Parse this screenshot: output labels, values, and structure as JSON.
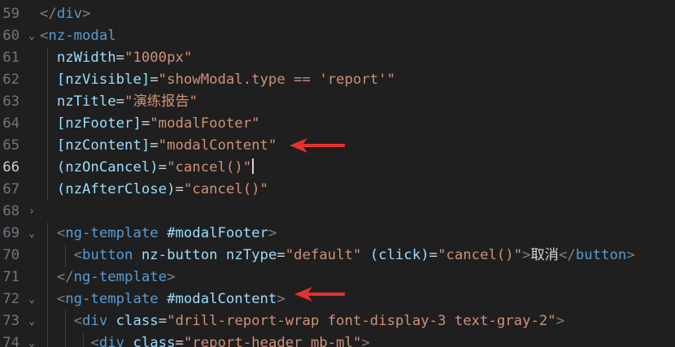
{
  "editor": {
    "active_line": "66",
    "fold_chevrons": {
      "down": "⌄",
      "right": "›"
    },
    "colors": {
      "background": "#1f1f1f",
      "tag": "#569cd6",
      "attribute": "#9cdcfe",
      "string": "#ce9178",
      "text": "#d4d4d4",
      "punctuation": "#808080",
      "annotation_arrow": "#e5322e"
    },
    "lines": [
      {
        "num": "59",
        "fold": "",
        "parts": [
          {
            "t": "</",
            "c": "gray"
          },
          {
            "t": "div",
            "c": "tag"
          },
          {
            "t": ">",
            "c": "gray"
          }
        ]
      },
      {
        "num": "60",
        "fold": "down",
        "parts": [
          {
            "t": "<",
            "c": "gray"
          },
          {
            "t": "nz-modal",
            "c": "tag"
          }
        ]
      },
      {
        "num": "61",
        "fold": "",
        "parts": [
          {
            "t": "  ",
            "c": "text"
          },
          {
            "t": "nzWidth",
            "c": "attr"
          },
          {
            "t": "=",
            "c": "text"
          },
          {
            "t": "\"1000px\"",
            "c": "str"
          }
        ]
      },
      {
        "num": "62",
        "fold": "",
        "parts": [
          {
            "t": "  ",
            "c": "text"
          },
          {
            "t": "[nzVisible]",
            "c": "attr"
          },
          {
            "t": "=",
            "c": "text"
          },
          {
            "t": "\"showModal.type == 'report'\"",
            "c": "str"
          }
        ]
      },
      {
        "num": "63",
        "fold": "",
        "parts": [
          {
            "t": "  ",
            "c": "text"
          },
          {
            "t": "nzTitle",
            "c": "attr"
          },
          {
            "t": "=",
            "c": "text"
          },
          {
            "t": "\"",
            "c": "str"
          },
          {
            "t": "演练报告",
            "c": "str cjk"
          },
          {
            "t": "\"",
            "c": "str"
          }
        ]
      },
      {
        "num": "64",
        "fold": "",
        "parts": [
          {
            "t": "  ",
            "c": "text"
          },
          {
            "t": "[nzFooter]",
            "c": "attr"
          },
          {
            "t": "=",
            "c": "text"
          },
          {
            "t": "\"modalFooter\"",
            "c": "str"
          }
        ]
      },
      {
        "num": "65",
        "fold": "",
        "parts": [
          {
            "t": "  ",
            "c": "text"
          },
          {
            "t": "[nzContent]",
            "c": "attr"
          },
          {
            "t": "=",
            "c": "text"
          },
          {
            "t": "\"modalContent\"",
            "c": "str"
          }
        ]
      },
      {
        "num": "66",
        "fold": "",
        "cursor": true,
        "parts": [
          {
            "t": "  ",
            "c": "text"
          },
          {
            "t": "(nzOnCancel)",
            "c": "attr"
          },
          {
            "t": "=",
            "c": "text"
          },
          {
            "t": "\"cancel()\"",
            "c": "str"
          }
        ]
      },
      {
        "num": "67",
        "fold": "",
        "parts": [
          {
            "t": "  ",
            "c": "text"
          },
          {
            "t": "(nzAfterClose)",
            "c": "attr"
          },
          {
            "t": "=",
            "c": "text"
          },
          {
            "t": "\"cancel()\"",
            "c": "str"
          }
        ]
      },
      {
        "num": "68",
        "fold": "right",
        "parts": [
          {
            "t": "",
            "c": "text"
          }
        ]
      },
      {
        "num": "69",
        "fold": "down",
        "parts": [
          {
            "t": "  ",
            "c": "text"
          },
          {
            "t": "<",
            "c": "gray"
          },
          {
            "t": "ng-template",
            "c": "tag"
          },
          {
            "t": " ",
            "c": "text"
          },
          {
            "t": "#modalFooter",
            "c": "attr"
          },
          {
            "t": ">",
            "c": "gray"
          }
        ]
      },
      {
        "num": "70",
        "fold": "",
        "parts": [
          {
            "t": "    ",
            "c": "text"
          },
          {
            "t": "<",
            "c": "gray"
          },
          {
            "t": "button",
            "c": "tag"
          },
          {
            "t": " ",
            "c": "text"
          },
          {
            "t": "nz-button",
            "c": "attr"
          },
          {
            "t": " ",
            "c": "text"
          },
          {
            "t": "nzType",
            "c": "attr"
          },
          {
            "t": "=",
            "c": "text"
          },
          {
            "t": "\"default\"",
            "c": "str"
          },
          {
            "t": " ",
            "c": "text"
          },
          {
            "t": "(click)",
            "c": "attr"
          },
          {
            "t": "=",
            "c": "text"
          },
          {
            "t": "\"cancel()\"",
            "c": "str"
          },
          {
            "t": ">",
            "c": "gray"
          },
          {
            "t": "取消",
            "c": "text cjk"
          },
          {
            "t": "</",
            "c": "gray"
          },
          {
            "t": "button",
            "c": "tag"
          },
          {
            "t": ">",
            "c": "gray"
          }
        ]
      },
      {
        "num": "71",
        "fold": "",
        "parts": [
          {
            "t": "  ",
            "c": "text"
          },
          {
            "t": "</",
            "c": "gray"
          },
          {
            "t": "ng-template",
            "c": "tag"
          },
          {
            "t": ">",
            "c": "gray"
          }
        ]
      },
      {
        "num": "72",
        "fold": "down",
        "parts": [
          {
            "t": "  ",
            "c": "text"
          },
          {
            "t": "<",
            "c": "gray"
          },
          {
            "t": "ng-template",
            "c": "tag"
          },
          {
            "t": " ",
            "c": "text"
          },
          {
            "t": "#modalContent",
            "c": "attr"
          },
          {
            "t": ">",
            "c": "gray"
          }
        ]
      },
      {
        "num": "73",
        "fold": "down",
        "parts": [
          {
            "t": "    ",
            "c": "text"
          },
          {
            "t": "<",
            "c": "gray"
          },
          {
            "t": "div",
            "c": "tag"
          },
          {
            "t": " ",
            "c": "text"
          },
          {
            "t": "class",
            "c": "attr"
          },
          {
            "t": "=",
            "c": "text"
          },
          {
            "t": "\"drill-report-wrap font-display-3 text-gray-2\"",
            "c": "str"
          },
          {
            "t": ">",
            "c": "gray"
          }
        ]
      },
      {
        "num": "74",
        "fold": "down",
        "parts": [
          {
            "t": "      ",
            "c": "text"
          },
          {
            "t": "<",
            "c": "gray"
          },
          {
            "t": "div",
            "c": "tag"
          },
          {
            "t": " ",
            "c": "text"
          },
          {
            "t": "class",
            "c": "attr"
          },
          {
            "t": "=",
            "c": "text"
          },
          {
            "t": "\"report-header mb-ml\"",
            "c": "str"
          },
          {
            "t": ">",
            "c": "gray"
          }
        ]
      }
    ]
  }
}
